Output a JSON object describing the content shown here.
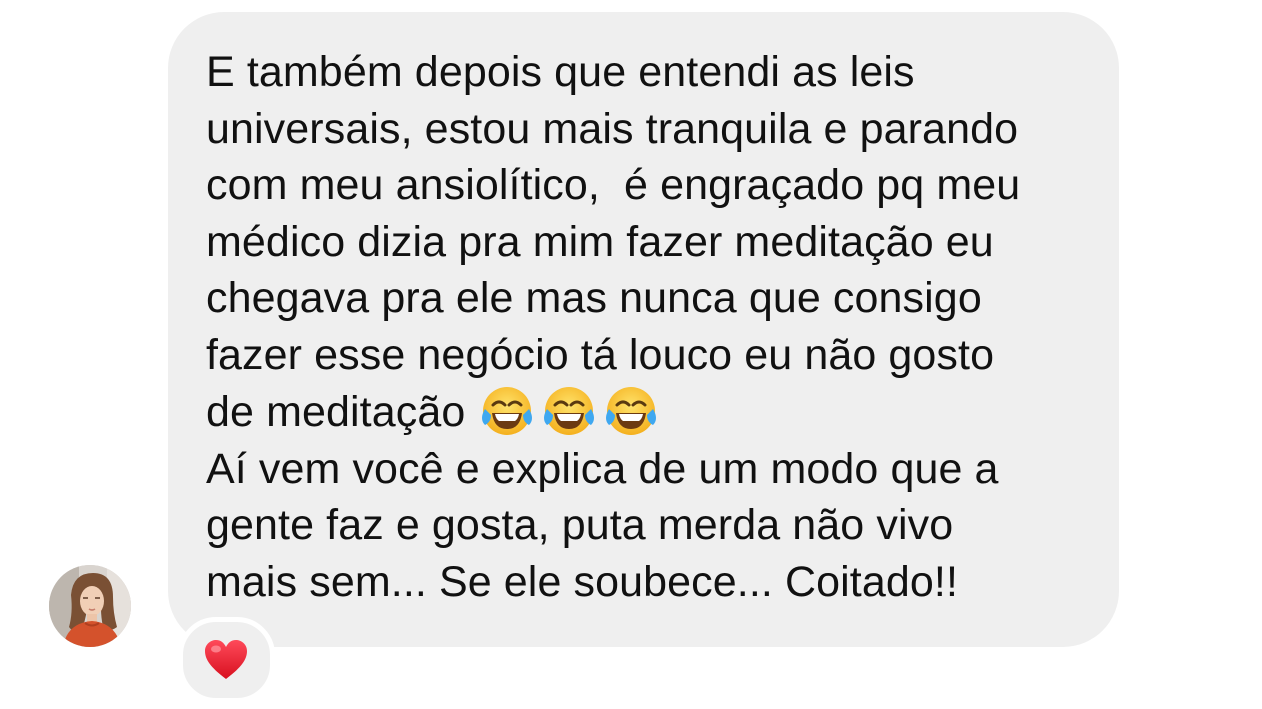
{
  "message": {
    "lines": [
      "E também depois que entendi as leis",
      "universais, estou mais tranquila e parando",
      "com meu ansiolítico,  é engraçado pq meu",
      "médico dizia pra mim fazer meditação eu",
      "chegava pra ele mas nunca que consigo",
      "fazer esse negócio tá louco eu não gosto",
      "de meditação",
      "Aí vem você e explica de um modo que a",
      "gente faz e gosta, puta merda não vivo",
      "mais sem... Se ele soubece... Coitado!!"
    ],
    "emojis": [
      "face-with-tears-of-joy",
      "face-with-tears-of-joy",
      "face-with-tears-of-joy"
    ],
    "bubble_color": "#efefef",
    "text_color": "#111111"
  },
  "reaction": {
    "icon": "red-heart-icon",
    "color": "#e8192c"
  },
  "sender": {
    "avatar_icon": "profile-photo"
  }
}
